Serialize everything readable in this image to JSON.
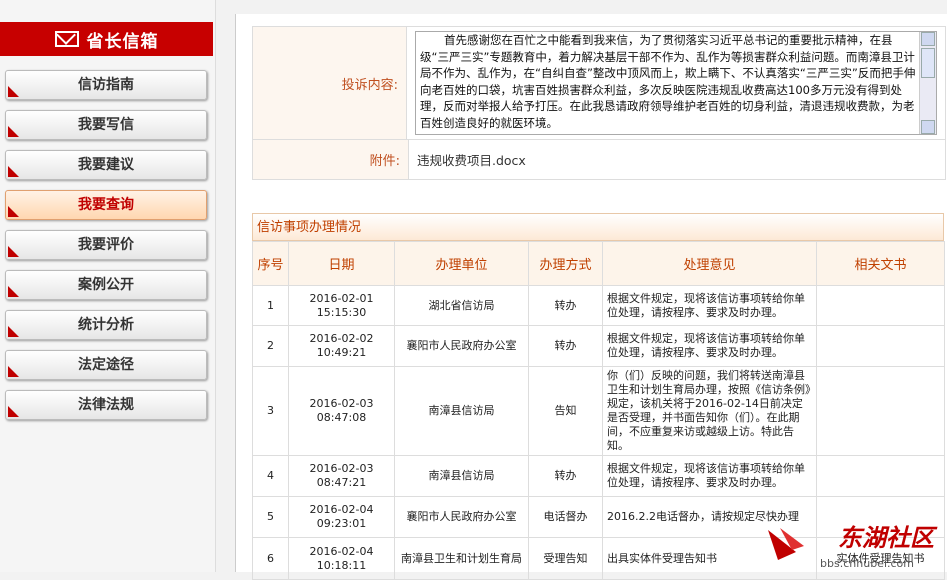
{
  "sidebar": {
    "title": "省长信箱",
    "items": [
      {
        "label": "信访指南",
        "active": false
      },
      {
        "label": "我要写信",
        "active": false
      },
      {
        "label": "我要建议",
        "active": false
      },
      {
        "label": "我要查询",
        "active": true
      },
      {
        "label": "我要评价",
        "active": false
      },
      {
        "label": "案例公开",
        "active": false
      },
      {
        "label": "统计分析",
        "active": false
      },
      {
        "label": "法定途径",
        "active": false
      },
      {
        "label": "法律法规",
        "active": false
      }
    ]
  },
  "complaint": {
    "label": "投诉内容:",
    "text": "首先感谢您在百忙之中能看到我来信，为了贯彻落实习近平总书记的重要批示精神，在县级“三严三实”专题教育中，着力解决基层干部不作为、乱作为等损害群众利益问题。而南漳县卫计局不作为、乱作为，在“自纠自查”整改中顶风而上，欺上瞒下、不认真落实“三严三实”反而把手伸向老百姓的口袋，坑害百姓损害群众利益，多次反映医院违规乱收费高达100多万元没有得到处理，反而对举报人给予打压。在此我恳请政府领导维护老百姓的切身利益，清退违规收费款，为老百姓创造良好的就医环境。"
  },
  "attachment": {
    "label": "附件:",
    "file": "违规收费项目.docx"
  },
  "process": {
    "title": "信访事项办理情况",
    "headers": [
      "序号",
      "日期",
      "办理单位",
      "办理方式",
      "处理意见",
      "相关文书"
    ],
    "rows": [
      {
        "no": "1",
        "date": "2016-02-01",
        "time": "15:15:30",
        "unit": "湖北省信访局",
        "method": "转办",
        "opinion": "根据文件规定，现将该信访事项转给你单位处理，请按程序、要求及时办理。",
        "doc": ""
      },
      {
        "no": "2",
        "date": "2016-02-02",
        "time": "10:49:21",
        "unit": "襄阳市人民政府办公室",
        "method": "转办",
        "opinion": "根据文件规定，现将该信访事项转给你单位处理，请按程序、要求及时办理。",
        "doc": ""
      },
      {
        "no": "3",
        "date": "2016-02-03",
        "time": "08:47:08",
        "unit": "南漳县信访局",
        "method": "告知",
        "opinion": "你（们）反映的问题，我们将转送南漳县卫生和计划生育局办理，按照《信访条例》规定，该机关将于2016-02-14日前决定是否受理，并书面告知你（们）。在此期间，不应重复来访或越级上访。特此告知。",
        "doc": ""
      },
      {
        "no": "4",
        "date": "2016-02-03",
        "time": "08:47:21",
        "unit": "南漳县信访局",
        "method": "转办",
        "opinion": "根据文件规定，现将该信访事项转给你单位处理，请按程序、要求及时办理。",
        "doc": ""
      },
      {
        "no": "5",
        "date": "2016-02-04",
        "time": "09:23:01",
        "unit": "襄阳市人民政府办公室",
        "method": "电话督办",
        "opinion": "2016.2.2电话督办，请按规定尽快办理",
        "doc": ""
      },
      {
        "no": "6",
        "date": "2016-02-04",
        "time": "10:18:11",
        "unit": "南漳县卫生和计划生育局",
        "method": "受理告知",
        "opinion": "出具实体件受理告知书",
        "doc": "实体件受理告知书"
      }
    ]
  },
  "watermark": {
    "name": "东湖社区",
    "url": "bbs.cnhubei.com"
  },
  "colors": {
    "brand_red": "#c70000",
    "label_orange": "#c04000"
  }
}
